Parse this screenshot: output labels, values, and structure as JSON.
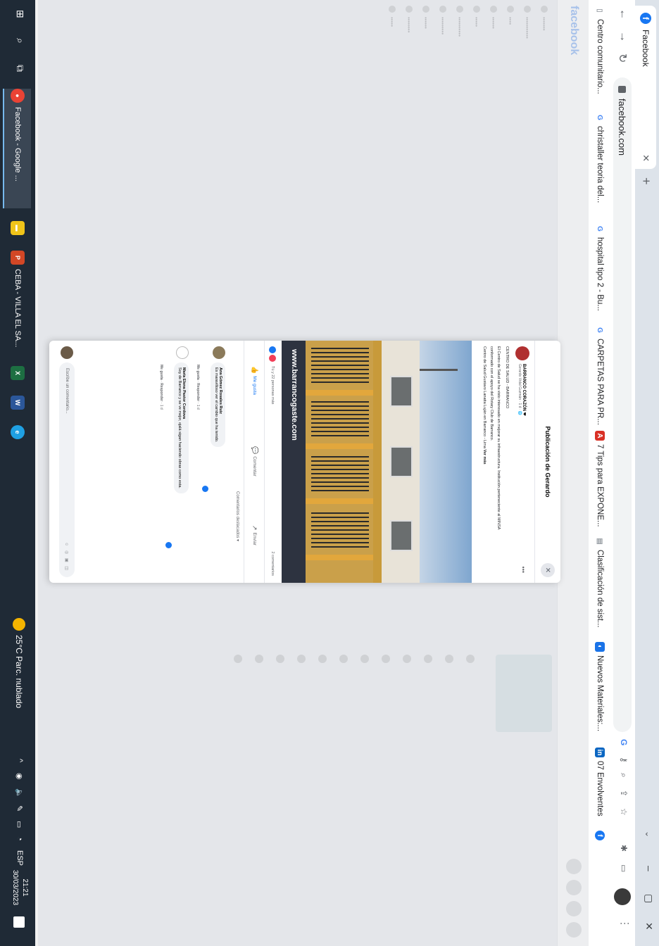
{
  "browser": {
    "tab_title": "Facebook",
    "tab_icon": "facebook-icon",
    "new_tab_label": "+",
    "url": "facebook.com",
    "window_controls": [
      "⌄",
      "–",
      "▢",
      "✕"
    ]
  },
  "bookmarks": [
    {
      "label": "Centro comunitario...",
      "icon": "folder-icon",
      "color": "#9aa0a6"
    },
    {
      "label": "christaller teoria del...",
      "icon": "google-icon",
      "color": "#4285f4"
    },
    {
      "label": "hospital tipo 2 - Bu...",
      "icon": "google-icon",
      "color": "#4285f4"
    },
    {
      "label": "CARPETAS PARA PR...",
      "icon": "google-icon",
      "color": "#4285f4"
    },
    {
      "label": "7 Tips para EXPONE...",
      "icon": "slides-icon",
      "color": "#d93025"
    },
    {
      "label": "Clasificación de sist...",
      "icon": "document-icon",
      "color": "#9aa0a6"
    },
    {
      "label": "Nuevos Materiales:...",
      "icon": "materials-icon",
      "color": "#1a73e8"
    },
    {
      "label": "07 Envolventes",
      "icon": "linkedin-icon",
      "color": "#0a66c2"
    }
  ],
  "facebook": {
    "logo": "facebook",
    "modal_title": "Publicación de Gerardo",
    "close_label": "✕",
    "post": {
      "author": "BARRANCO CORAZÓN ❤",
      "meta": "Gerardo Vidal Guzmán · 1 d · 🌐",
      "lines": [
        "CENTRO DE SALUD - BARRANCO",
        "El Centro de Salud se ha visto interesado en mejorar su infraestructura. Institución perteneciente al MINSA",
        "conformado con el apoyo del Rotary Club de Barranco.",
        "Centro de Salud Gustavo Lanatta Luján en Barranco - Lima"
      ],
      "see_more": "Ver más",
      "watermark": "www.barrancogaste.com",
      "reactions_text": "Tú y 22 personas más",
      "comments_count": "2 comentarios"
    },
    "actions": {
      "like": "Me gusta",
      "comment": "Comentar",
      "share": "Enviar"
    },
    "filter_label": "Comentarios destacados ▾",
    "comments": [
      {
        "name": "Ana Gómez Rosales Ruiz",
        "text": "Es maravilloso ver el cambio que ha tenido.",
        "meta": [
          "Me gusta",
          "Responder",
          "1 d"
        ]
      },
      {
        "name": "María Elena Pastor Cordova",
        "text": "Soy de Barranco y se ve mejor, ojalá sigan haciendo obras como esta.",
        "meta": [
          "Me gusta",
          "Responder",
          "1 d"
        ]
      }
    ],
    "write_placeholder": "Escribe un comentario..."
  },
  "taskbar": {
    "apps": [
      {
        "label": "Facebook - Google ...",
        "icon": "chrome-icon",
        "color": "#ea4335",
        "active": true
      },
      {
        "label": "",
        "icon": "file-explorer-icon",
        "color": "#f0c419",
        "active": false
      },
      {
        "label": "CEBA - VILLA EL SA...",
        "icon": "powerpoint-icon",
        "color": "#d24726",
        "active": false
      },
      {
        "label": "",
        "icon": "excel-icon",
        "color": "#1d6f42",
        "active": false
      },
      {
        "label": "",
        "icon": "word-icon",
        "color": "#2b579a",
        "active": false
      },
      {
        "label": "",
        "icon": "edge-icon",
        "color": "#1fa0e3",
        "active": false
      }
    ],
    "weather": "25°C Parc. nublado",
    "tray_lang": "ESP",
    "time": "21:21",
    "date": "30/03/2023"
  }
}
